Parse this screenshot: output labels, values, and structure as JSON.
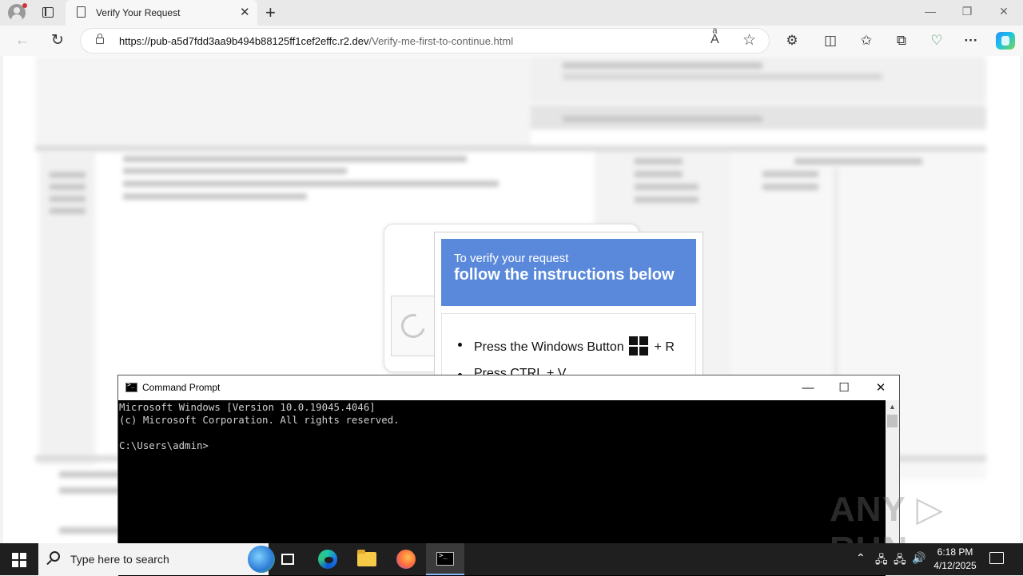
{
  "browser": {
    "tab_title": "Verify Your Request",
    "tab_close": "✕",
    "new_tab": "+",
    "url_host": "https://pub-a5d7fdd3aa9b494b88125ff1cef2effc.r2.dev",
    "url_path": "/Verify-me-first-to-continue.html",
    "window_minimize": "—",
    "window_restore": "❐",
    "window_close": "✕",
    "back": "←",
    "refresh": "↻",
    "read_aloud": "Aͣ",
    "favorite": "☆",
    "extensions": "⚙",
    "split": "◫",
    "favorites": "✩",
    "collections": "⧉",
    "performance": "♡",
    "more": "···"
  },
  "captcha": {
    "subheading": "To verify your request",
    "heading": "follow the instructions below",
    "step1_prefix": "Press the Windows Button",
    "step1_suffix": "+ R",
    "step2": "Press CTRL + V"
  },
  "cmd": {
    "title": "Command Prompt",
    "minimize": "—",
    "maximize": "☐",
    "close": "✕",
    "scroll_up": "▲",
    "lines": "Microsoft Windows [Version 10.0.19045.4046]\n(c) Microsoft Corporation. All rights reserved.\n\nC:\\Users\\admin>"
  },
  "watermark": "ANY ▷ RUN",
  "taskbar": {
    "search_placeholder": "Type here to search",
    "tray_chevron": "⌃",
    "tray_network": "🖧",
    "tray_volume": "🔊",
    "time": "6:18 PM",
    "date": "4/12/2025"
  }
}
